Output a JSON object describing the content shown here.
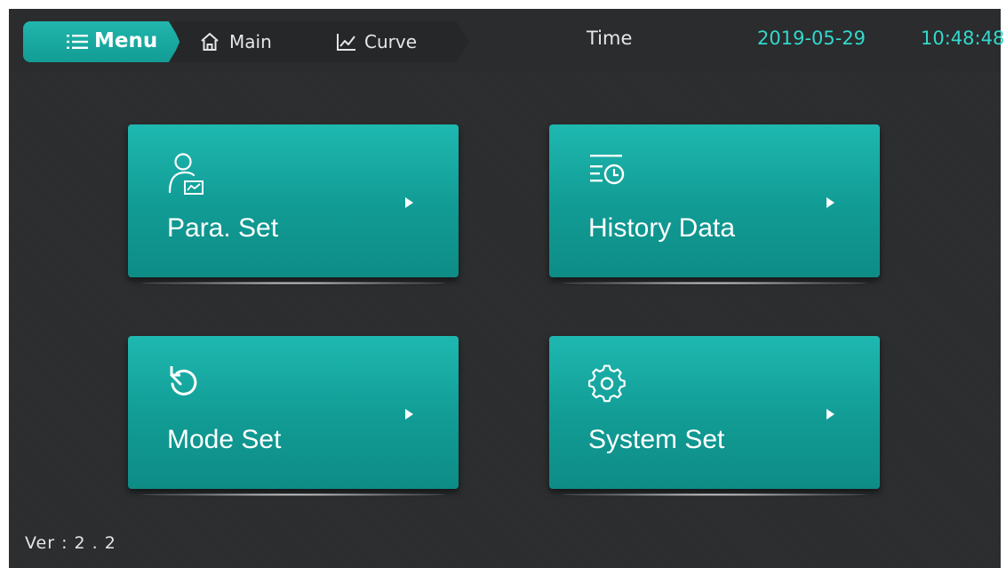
{
  "header": {
    "tabs": {
      "menu": {
        "label": "Menu",
        "icon": "list-icon"
      },
      "main": {
        "label": "Main",
        "icon": "home-icon"
      },
      "curve": {
        "label": "Curve",
        "icon": "chart-line-icon"
      }
    },
    "time_label": "Time",
    "date": "2019-05-29",
    "time": "10:48:48"
  },
  "tiles": [
    {
      "label": "Para. Set",
      "icon": "user-chart-icon"
    },
    {
      "label": "History Data",
      "icon": "history-clock-icon"
    },
    {
      "label": "Mode Set",
      "icon": "reset-arrow-icon"
    },
    {
      "label": "System Set",
      "icon": "gear-icon"
    }
  ],
  "version": "Ver : 2 . 2",
  "colors": {
    "background": "#2b2d2f",
    "accent": "#1eb8b0",
    "accent_text": "#33d8cc",
    "text": "#e6e6e6"
  }
}
